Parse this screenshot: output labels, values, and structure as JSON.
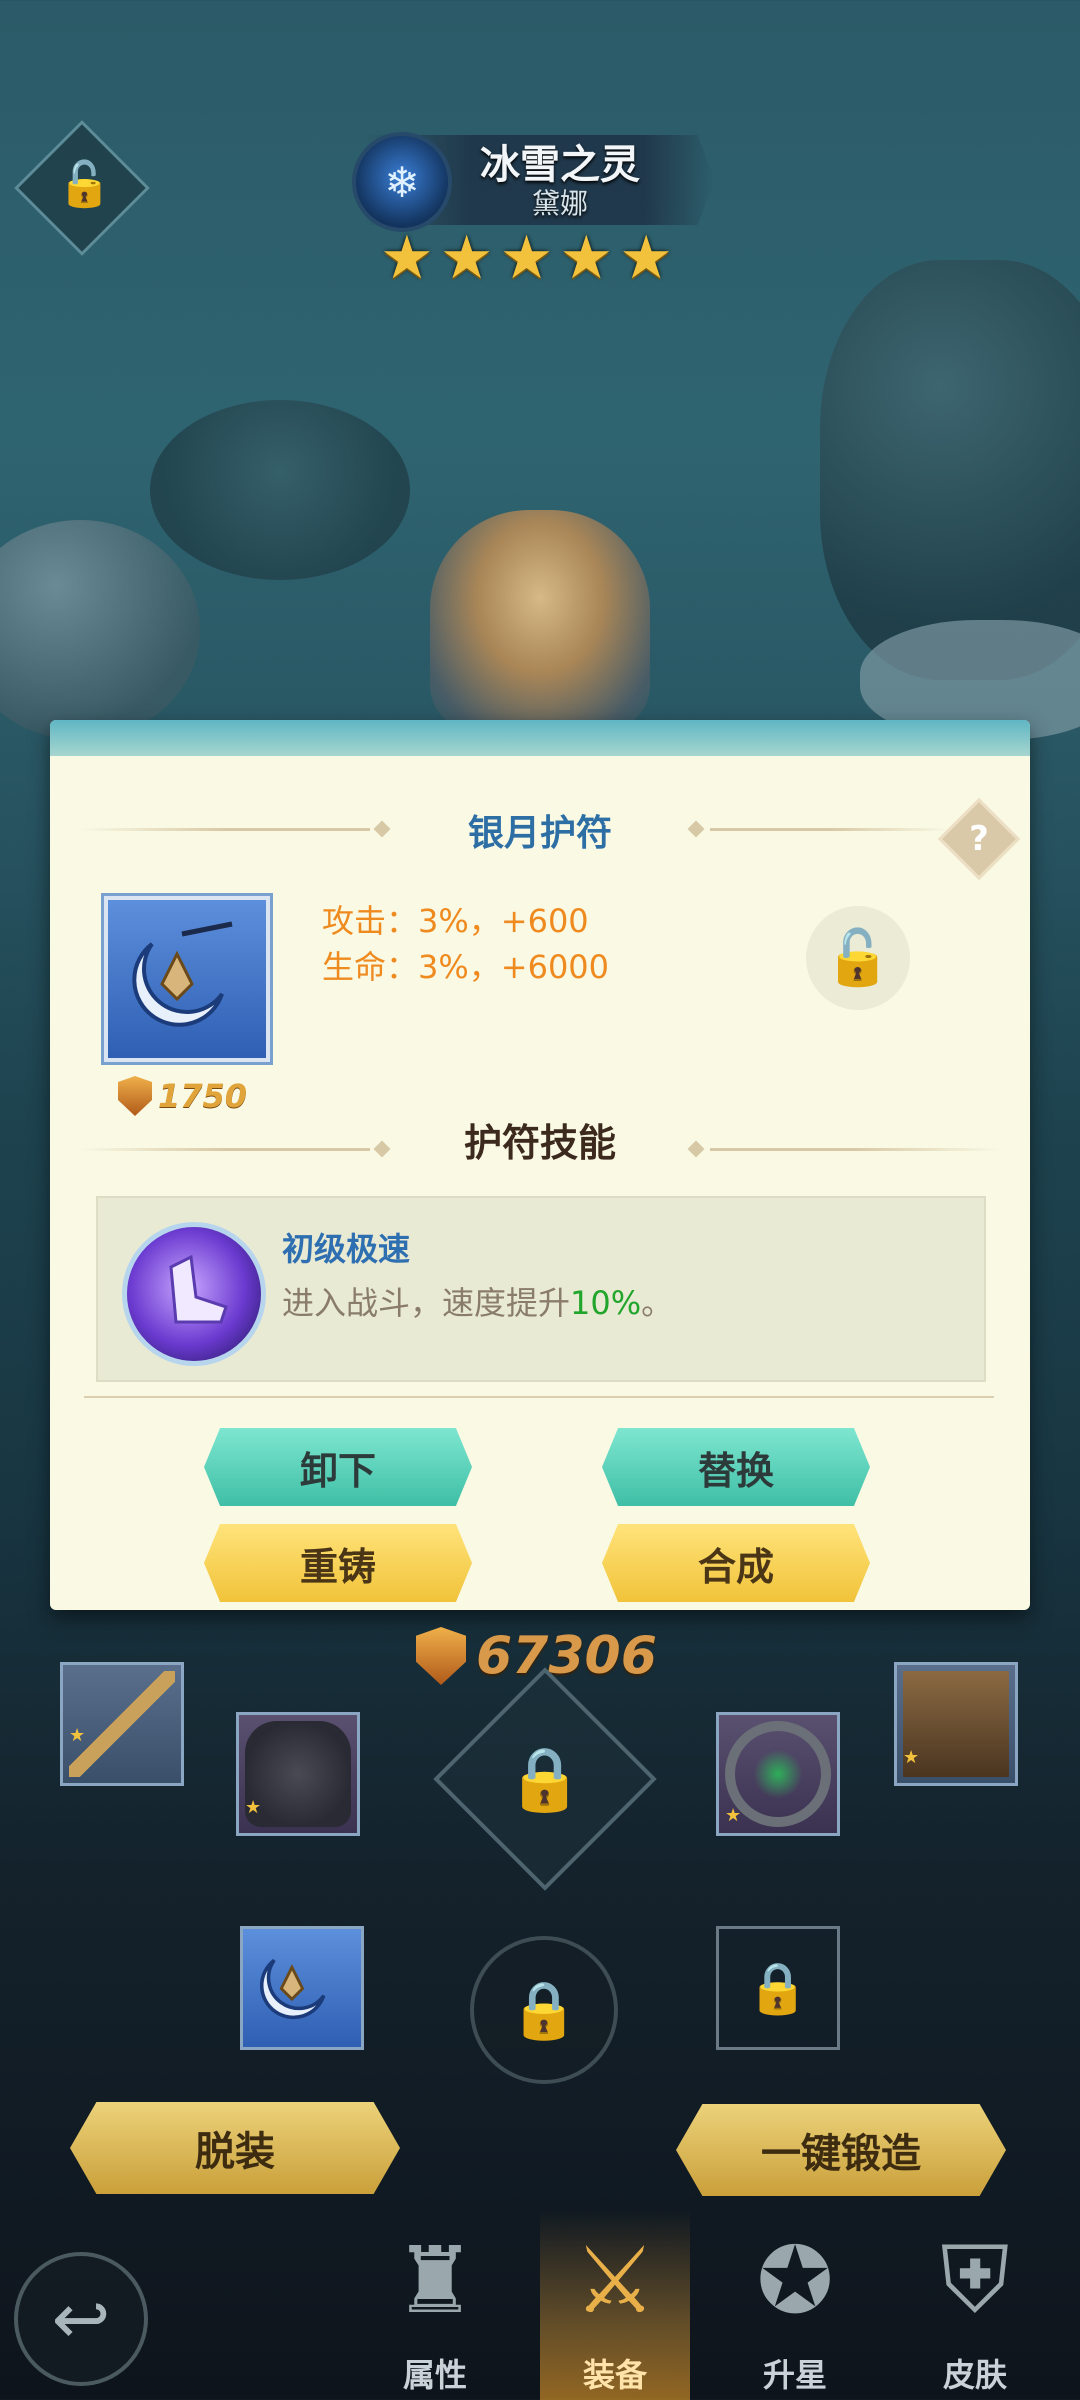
{
  "header": {
    "hero_name": "冰雪之灵",
    "hero_subname": "黛娜",
    "stars": 5
  },
  "panel": {
    "item_name": "银月护符",
    "help_label": "?",
    "stats": [
      "攻击：3%，+600",
      "生命：3%，+6000"
    ],
    "item_power": "1750",
    "skill_section_title": "护符技能",
    "skill": {
      "name": "初级极速",
      "desc_prefix": "进入战斗，速度提升",
      "desc_highlight": "10%",
      "desc_suffix": "。"
    },
    "buttons": {
      "unequip": "卸下",
      "replace": "替换",
      "reforge": "重铸",
      "combine": "合成"
    }
  },
  "equipment": {
    "total_power": "67306",
    "strip_button": "脱装",
    "forge_button": "一键锻造"
  },
  "nav": {
    "tabs": [
      "属性",
      "装备",
      "升星",
      "皮肤"
    ],
    "active_index": 1
  },
  "colors": {
    "accent_gold": "#f2c23d",
    "teal_button": "#4fcdb3",
    "gold_button": "#f5cf4e",
    "stat_orange": "#ef8a1f",
    "skill_blue": "#2e6fb1",
    "highlight_green": "#22a52c"
  }
}
